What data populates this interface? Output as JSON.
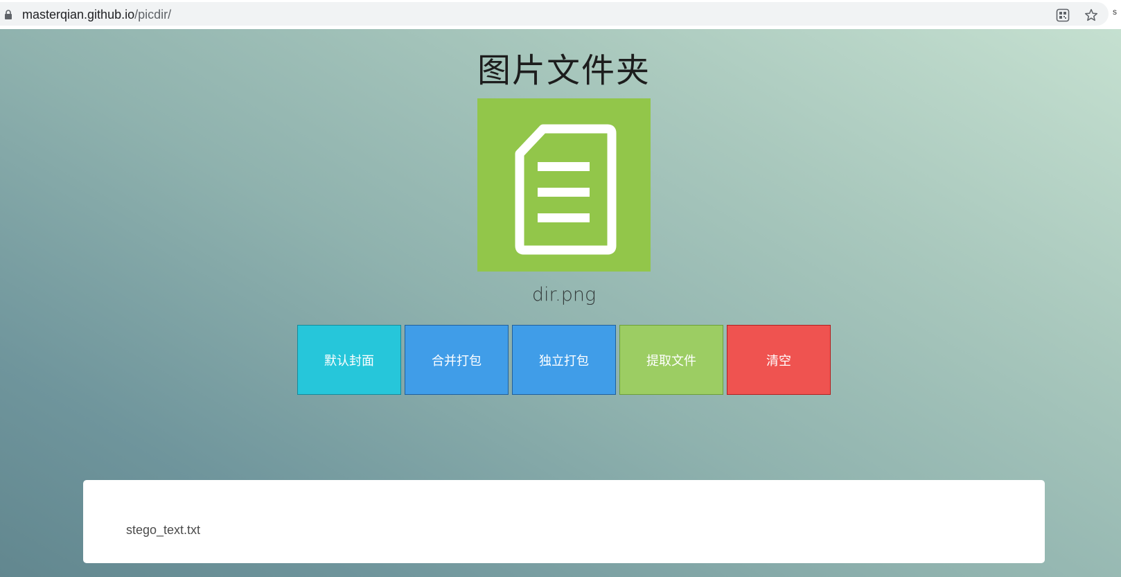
{
  "browser": {
    "url_host": "masterqian.github.io",
    "url_path": "/picdir/",
    "edge_text": "s"
  },
  "page": {
    "title": "图片文件夹",
    "cover": {
      "icon": "document-icon",
      "color": "#92c64a"
    },
    "filename": "dir.png",
    "buttons": [
      {
        "label": "默认封面",
        "color": "#26c6da"
      },
      {
        "label": "合并打包",
        "color": "#409de8"
      },
      {
        "label": "独立打包",
        "color": "#409de8"
      },
      {
        "label": "提取文件",
        "color": "#9ccd63"
      },
      {
        "label": "清空",
        "color": "#ef5350"
      }
    ],
    "files": [
      "stego_text.txt"
    ]
  }
}
